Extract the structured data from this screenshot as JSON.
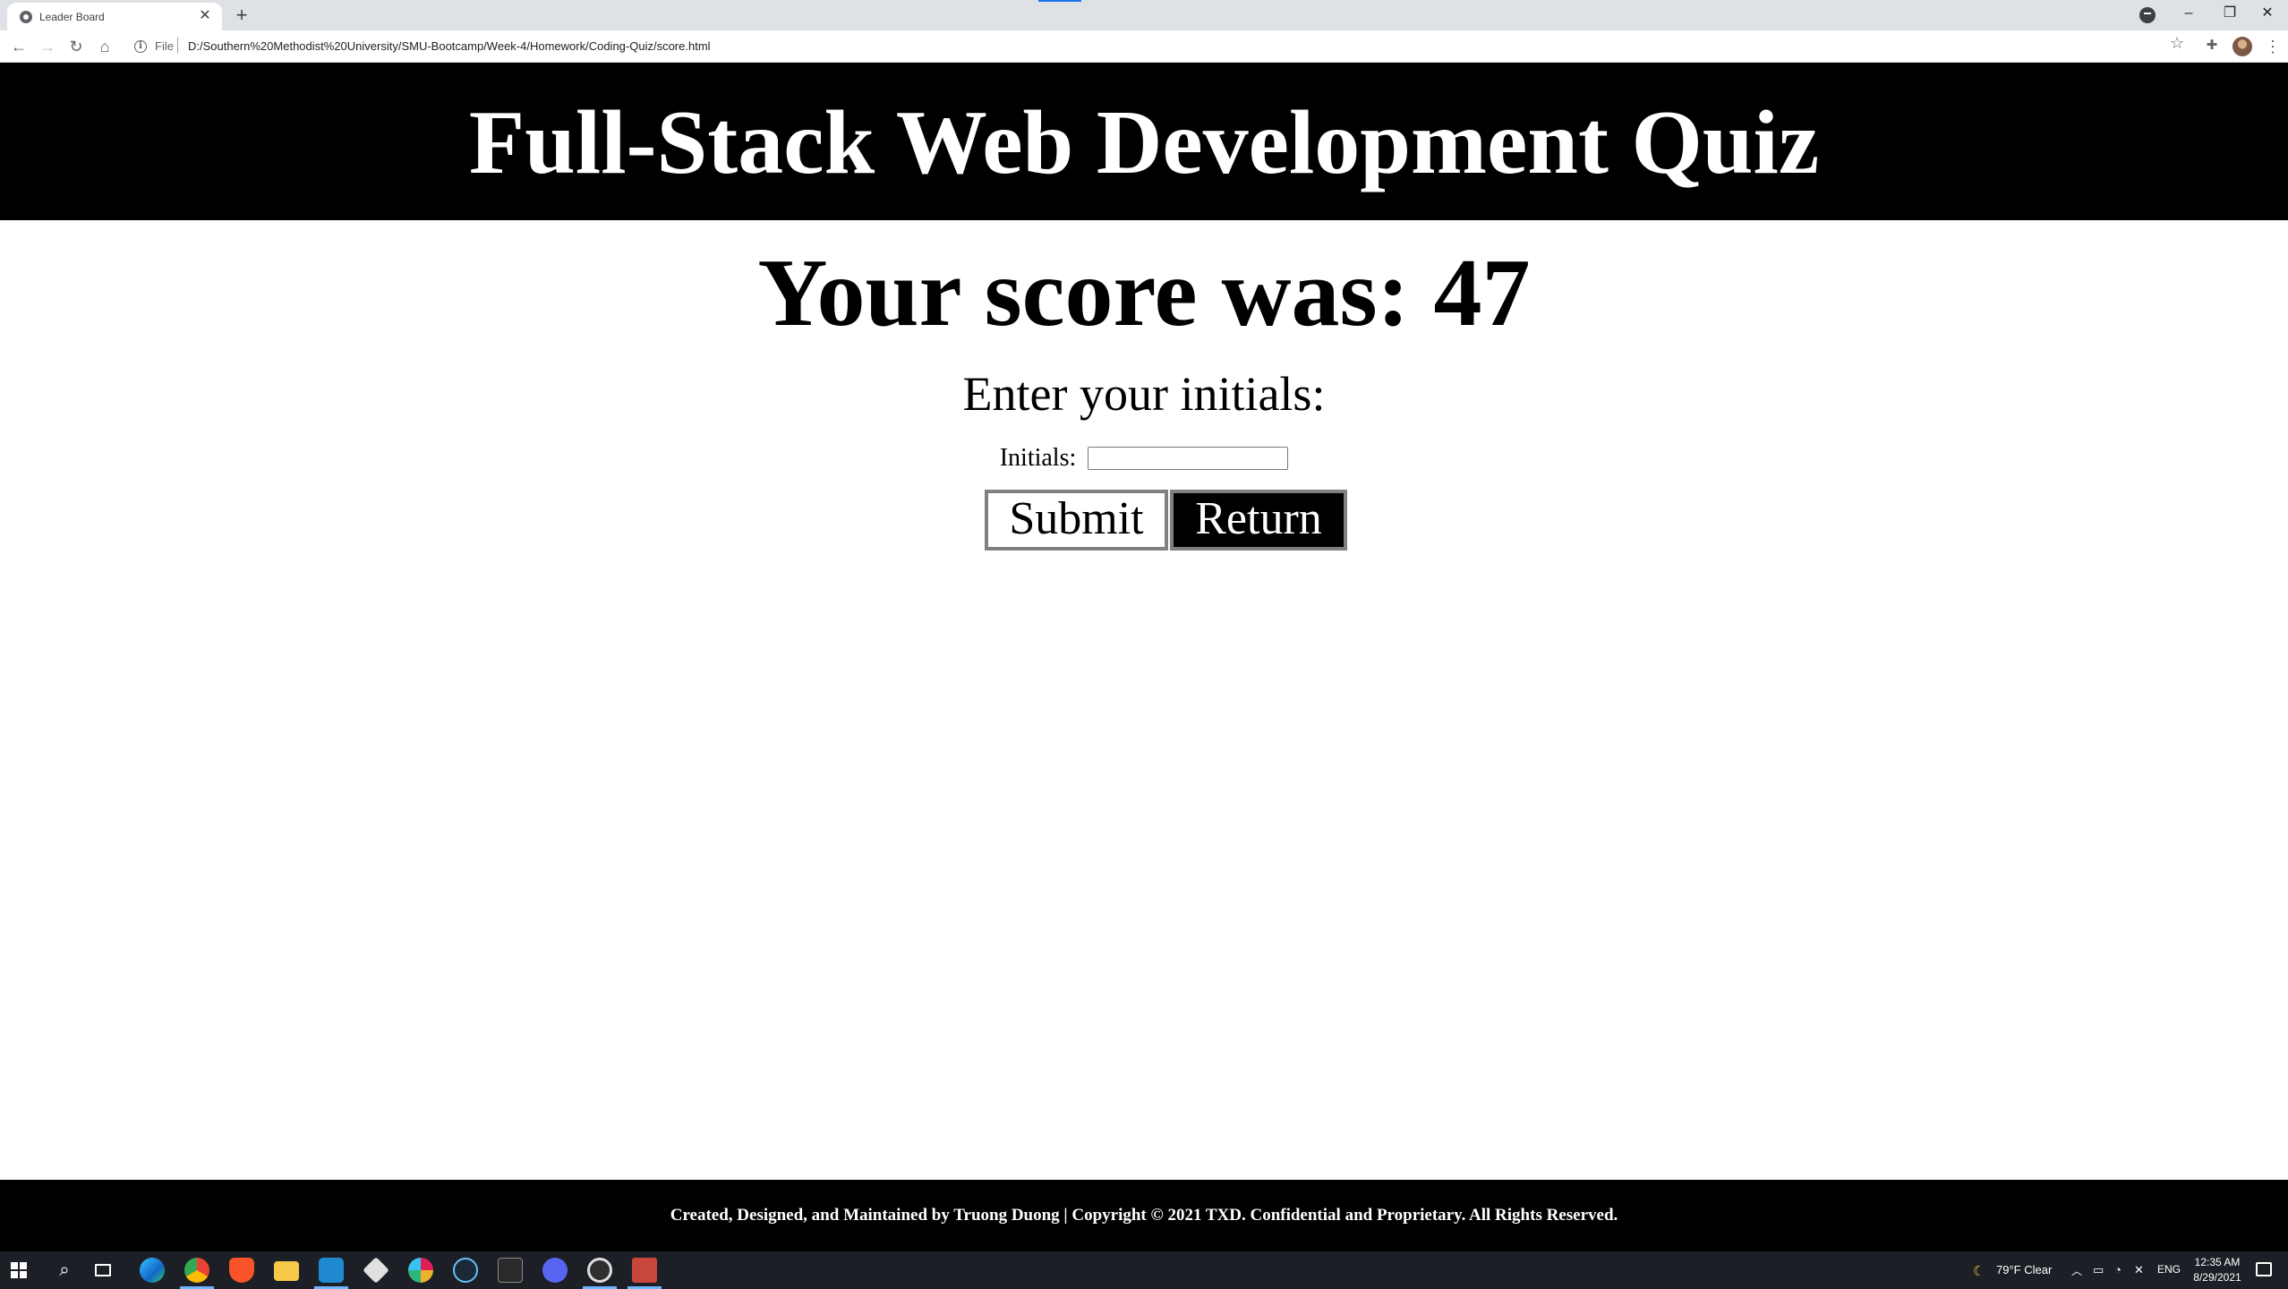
{
  "browser": {
    "tab_title": "Leader Board",
    "new_tab_symbol": "+",
    "url_scheme": "File",
    "url": "D:/Southern%20Methodist%20University/SMU-Bootcamp/Week-4/Homework/Coding-Quiz/score.html",
    "window_controls": [
      "–",
      "❐",
      "✕"
    ]
  },
  "page": {
    "header_title": "Full-Stack Web Development Quiz",
    "score_heading": "Your score was: 47",
    "initials_prompt": "Enter your initials:",
    "initials_label": "Initials:",
    "initials_value": "",
    "submit_label": "Submit",
    "return_label": "Return",
    "footer_text": "Created, Designed, and Maintained by Truong Duong | Copyright © 2021 TXD. Confidential and Proprietary. All Rights Reserved."
  },
  "taskbar": {
    "apps": [
      "windows-start",
      "search",
      "task-view",
      "edge",
      "chrome",
      "brave",
      "file-explorer",
      "vscode",
      "git",
      "slack",
      "steam",
      "epic-games",
      "discord",
      "obs",
      "app"
    ],
    "weather": "79°F  Clear",
    "language": "ENG",
    "time": "12:35 AM",
    "date": "8/29/2021"
  },
  "colors": {
    "header_bg": "#000000",
    "footer_bg": "#000000",
    "button_border": "#808080",
    "taskbar_bg": "#1c2026"
  }
}
